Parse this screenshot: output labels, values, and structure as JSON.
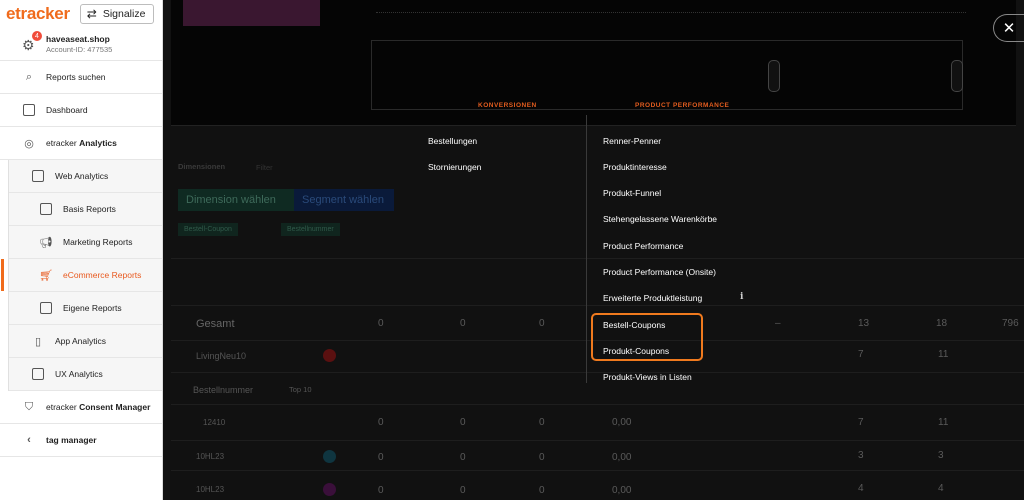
{
  "brand": {
    "logo": "etracker",
    "signalize": "Signalize"
  },
  "account": {
    "name": "haveaseat.shop",
    "id": "Account-ID: 477535",
    "badge_count": "4"
  },
  "sidebar": {
    "reports_search": "Reports suchen",
    "dashboard": "Dashboard",
    "analytics_prefix": "etracker",
    "analytics_name": "Analytics",
    "web_analytics": "Web Analytics",
    "basis": "Basis Reports",
    "marketing": "Marketing Reports",
    "ecommerce": "eCommerce Reports",
    "eigene": "Eigene Reports",
    "app": "App Analytics",
    "ux": "UX Analytics",
    "consent_prefix": "etracker",
    "consent_name": "Consent Manager",
    "tag": "tag manager"
  },
  "menu": {
    "col1_head": "KONVERSIONEN",
    "col2_head": "PRODUCT PERFORMANCE",
    "col1_items": [
      "Bestellungen",
      "Stornierungen"
    ],
    "col2_items": [
      "Renner-Penner",
      "Produktinteresse",
      "Produkt-Funnel",
      "Stehengelassene Warenkörbe",
      "Product Performance",
      "Product Performance (Onsite)",
      "Erweiterte Produktleistung",
      "Bestell-Coupons",
      "Produkt-Coupons",
      "Produkt-Views in Listen"
    ]
  },
  "background": {
    "dimension_btn": "Dimension wählen",
    "segment_btn": "Segment wählen",
    "chip1": "Bestell-Coupon",
    "chip2": "Bestellnummer",
    "dimensionen": "Dimensionen",
    "filter": "Filter",
    "gesamt": "Gesamt",
    "row1": "LivingNeu10",
    "row2": "Bestellnummer",
    "top": "Top 10",
    "row3": "12410",
    "row4": "10HL23",
    "row5": "10HL23",
    "zero": "0",
    "zero_money": "0,00",
    "dash": "–",
    "v13": "13",
    "v18": "18",
    "v796": "796",
    "v7": "7",
    "v11": "11",
    "v3": "3",
    "v4": "4"
  },
  "colors": {
    "accent": "#f06b1c",
    "highlight": "#f07a1e"
  }
}
